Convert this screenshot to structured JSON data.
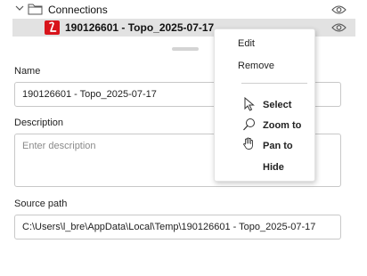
{
  "tree": {
    "root_label": "Connections",
    "item_label": "190126601 - Topo_2025-07-17"
  },
  "form": {
    "name_label": "Name",
    "name_value": "190126601 - Topo_2025-07-17",
    "description_label": "Description",
    "description_placeholder": "Enter description",
    "source_path_label": "Source path",
    "source_path_value": "C:\\Users\\l_bre\\AppData\\Local\\Temp\\190126601 - Topo_2025-07-17"
  },
  "context_menu": {
    "items": [
      {
        "label": "Edit"
      },
      {
        "label": "Remove"
      },
      {
        "label": "Select",
        "icon": "cursor-arrow-icon"
      },
      {
        "label": "Zoom to",
        "icon": "magnifier-icon"
      },
      {
        "label": "Pan to",
        "icon": "hand-icon"
      },
      {
        "label": "Hide"
      }
    ]
  },
  "colors": {
    "selected_row_bg": "#e2e2e2",
    "logo_red": "#d8141b"
  }
}
